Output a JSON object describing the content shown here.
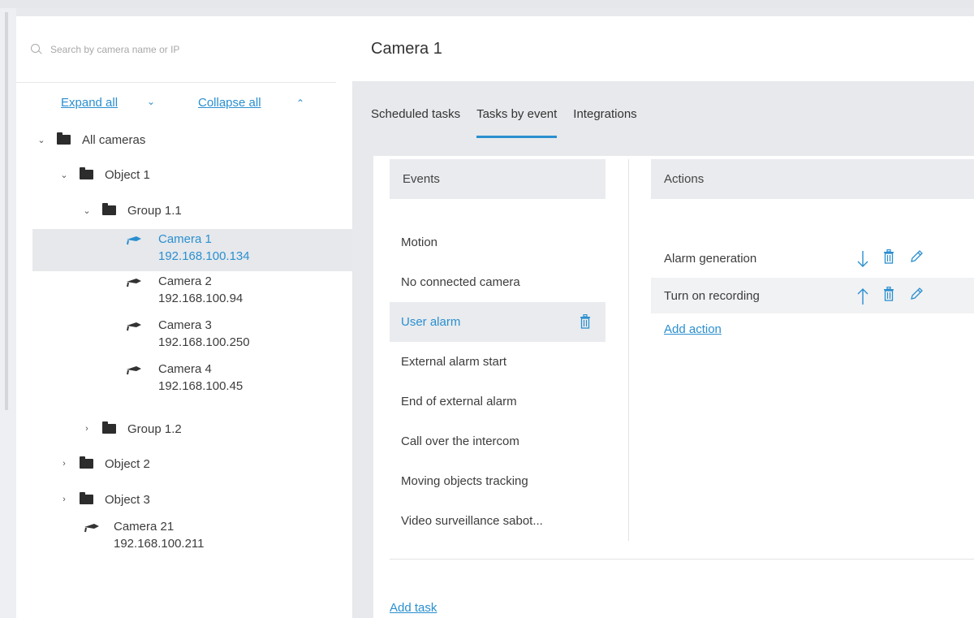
{
  "search": {
    "placeholder": "Search by camera name or IP"
  },
  "tree_controls": {
    "expand_all": "Expand all",
    "collapse_all": "Collapse all"
  },
  "tree": {
    "all_cameras": "All cameras",
    "object1": "Object 1",
    "group11": "Group 1.1",
    "group12": "Group 1.2",
    "object2": "Object 2",
    "object3": "Object 3",
    "cameras": [
      {
        "name": "Camera 1",
        "ip": "192.168.100.134"
      },
      {
        "name": "Camera 2",
        "ip": "192.168.100.94"
      },
      {
        "name": "Camera 3",
        "ip": "192.168.100.250"
      },
      {
        "name": "Camera 4",
        "ip": "192.168.100.45"
      },
      {
        "name": "Camera 21",
        "ip": "192.168.100.211"
      }
    ]
  },
  "header": {
    "title": "Camera 1"
  },
  "tabs": [
    {
      "label": "Scheduled tasks"
    },
    {
      "label": "Tasks by event"
    },
    {
      "label": "Integrations"
    }
  ],
  "events": {
    "header": "Events",
    "items": [
      "Motion",
      "No connected camera",
      "User alarm",
      "External alarm start",
      "End of external alarm",
      "Call over the intercom",
      "Moving objects tracking",
      "Video surveillance sabot..."
    ]
  },
  "actions": {
    "header": "Actions",
    "items": [
      "Alarm generation",
      "Turn on recording"
    ],
    "add_label": "Add action"
  },
  "add_task_label": "Add task",
  "colors": {
    "accent": "#2a8fcf",
    "selected_bg": "#e6e8ec",
    "header_bg": "#e9ebee"
  }
}
